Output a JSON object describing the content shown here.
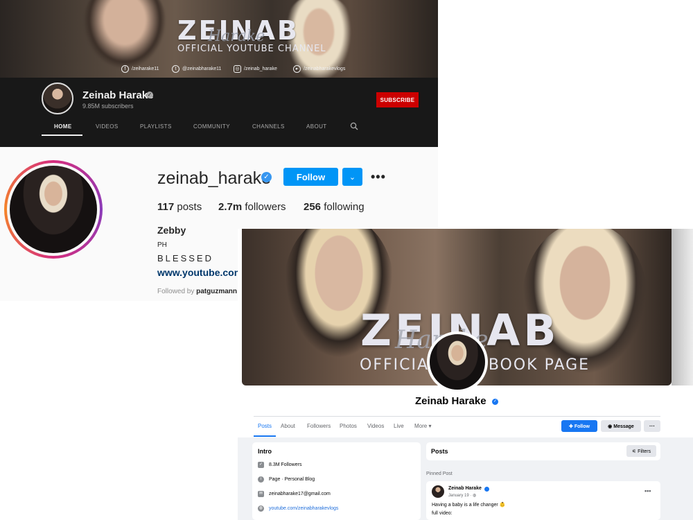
{
  "youtube": {
    "banner": {
      "brand": "ZEINAB",
      "script": "Harake",
      "subtitle": "OFFICIAL YOUTUBE CHANNEL",
      "socials": [
        {
          "icon": "facebook-icon",
          "handle": "/zeiharake11"
        },
        {
          "icon": "twitter-icon",
          "handle": "@zeinabharake11"
        },
        {
          "icon": "instagram-icon",
          "handle": "/zeinab_harake"
        },
        {
          "icon": "youtube-icon",
          "handle": "/zeinabharakevlogs"
        }
      ]
    },
    "channel_name": "Zeinab Harake",
    "subscribers": "9.85M subscribers",
    "subscribe_label": "SUBSCRIBE",
    "tabs": [
      "HOME",
      "VIDEOS",
      "PLAYLISTS",
      "COMMUNITY",
      "CHANNELS",
      "ABOUT"
    ],
    "accent": "#cc0000"
  },
  "instagram": {
    "username": "zeinab_harake",
    "follow_label": "Follow",
    "stats": {
      "posts": {
        "value": "117",
        "label": "posts"
      },
      "followers": {
        "value": "2.7m",
        "label": "followers"
      },
      "following": {
        "value": "256",
        "label": "following"
      }
    },
    "full_name": "Zebby",
    "location": "PH",
    "bio": "BLESSED",
    "link": "www.youtube.com/",
    "followed_by_prefix": "Followed by",
    "followed_by_user": "patguzmann",
    "accent": "#0095f6"
  },
  "facebook": {
    "cover": {
      "brand": "ZEINAB",
      "script": "Harake",
      "subtitle": "OFFICIAL FACEBOOK PAGE"
    },
    "page_name": "Zeinab Harake",
    "tabs": [
      "Posts",
      "About",
      "Followers",
      "Photos",
      "Videos",
      "Live",
      "More ▾"
    ],
    "follow_label": "Follow",
    "message_label": "Message",
    "more_label": "···",
    "intro": {
      "title": "Intro",
      "rows": [
        {
          "icon": "followers-icon",
          "text": "8.3M Followers"
        },
        {
          "icon": "info-icon",
          "text": "Page · Personal Blog"
        },
        {
          "icon": "email-icon",
          "text": "zeinabharake17@gmail.com"
        },
        {
          "icon": "globe-icon",
          "text": "youtube.com/zeinabharakevlogs"
        }
      ]
    },
    "posts_title": "Posts",
    "filters_label": "Filters",
    "pinned_label": "Pinned Post",
    "post": {
      "author": "Zeinab Harake",
      "date": "January 19 · ",
      "text1": "Having a baby is a life changer 👶",
      "text2": "full video:"
    },
    "accent": "#1877f2"
  }
}
